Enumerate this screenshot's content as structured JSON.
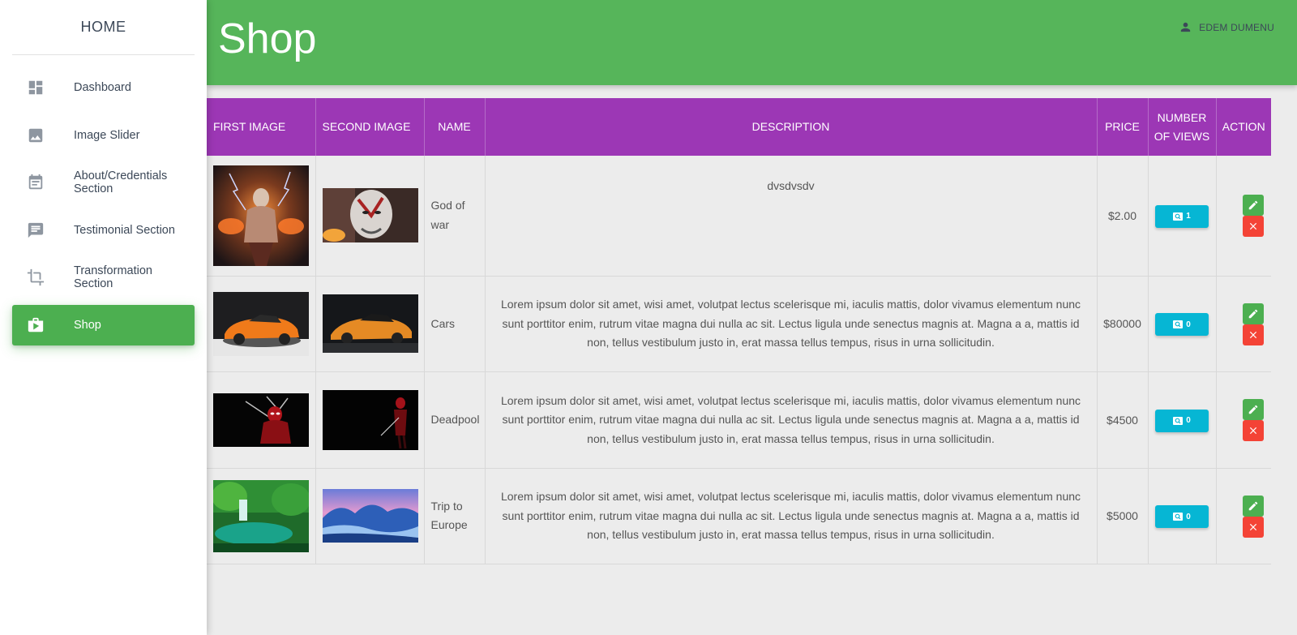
{
  "sidebar": {
    "brand": "HOME",
    "items": [
      {
        "label": "Dashboard",
        "icon": "dashboard-icon"
      },
      {
        "label": "Image Slider",
        "icon": "image-icon"
      },
      {
        "label": "About/Credentials Section",
        "icon": "event-note-icon"
      },
      {
        "label": "Testimonial Section",
        "icon": "chat-icon"
      },
      {
        "label": "Transformation Section",
        "icon": "crop-icon"
      },
      {
        "label": "Shop",
        "icon": "shop-icon",
        "active": true
      }
    ]
  },
  "header": {
    "title": "Shop",
    "user_name": "EDEM DUMENU",
    "user_icon": "person-icon"
  },
  "table": {
    "headers": {
      "first_image": "FIRST IMAGE",
      "second_image": "SECOND IMAGE",
      "name": "NAME",
      "description": "DESCRIPTION",
      "price": "PRICE",
      "views_line1": "NUMBER",
      "views_line2": "OF VIEWS",
      "action": "ACTION"
    },
    "rows": [
      {
        "name": "God of war",
        "description": "dvsdvsdv",
        "price": "$2.00",
        "views": "1"
      },
      {
        "name": "Cars",
        "description": "Lorem ipsum dolor sit amet, wisi amet, volutpat lectus scelerisque mi, iaculis mattis, dolor vivamus elementum nunc sunt porttitor enim, rutrum vitae magna dui nulla ac sit. Lectus ligula unde senectus magnis at. Magna a a, mattis id non, tellus vestibulum justo in, erat massa tellus tempus, risus in urna sollicitudin.",
        "price": "$80000",
        "views": "0"
      },
      {
        "name": "Deadpool",
        "description": "Lorem ipsum dolor sit amet, wisi amet, volutpat lectus scelerisque mi, iaculis mattis, dolor vivamus elementum nunc sunt porttitor enim, rutrum vitae magna dui nulla ac sit. Lectus ligula unde senectus magnis at. Magna a a, mattis id non, tellus vestibulum justo in, erat massa tellus tempus, risus in urna sollicitudin.",
        "price": "$4500",
        "views": "0"
      },
      {
        "name": "Trip to Europe",
        "description": "Lorem ipsum dolor sit amet, wisi amet, volutpat lectus scelerisque mi, iaculis mattis, dolor vivamus elementum nunc sunt porttitor enim, rutrum vitae magna dui nulla ac sit. Lectus ligula unde senectus magnis at. Magna a a, mattis id non, tellus vestibulum justo in, erat massa tellus tempus, risus in urna sollicitudin.",
        "price": "$5000",
        "views": "0"
      }
    ]
  },
  "colors": {
    "primary_green": "#56b55a",
    "header_purple": "#9c37b5",
    "views_cyan": "#06b6d4",
    "edit_green": "#4caf50",
    "delete_red": "#f44336"
  }
}
